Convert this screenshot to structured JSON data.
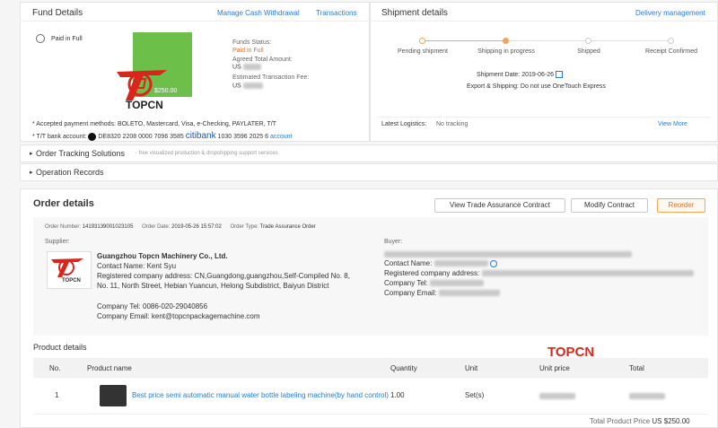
{
  "fund": {
    "title": "Fund Details",
    "manage_link": "Manage Cash Withdrawal",
    "transactions_link": "Transactions",
    "paid_badge": "Paid in Full",
    "funds_status_label": "Funds Status:",
    "funds_status_value": "Paid in Full",
    "agreed_total_label": "Agreed Total Amount:",
    "agreed_total_prefix": "US",
    "est_fee_label": "Estimated Transaction Fee:",
    "est_fee_prefix": "US",
    "paid_amount": "$250.00",
    "payment_methods": "* Accepted payment methods: BOLETO, Mastercard, Visa, e-Checking, PAYLATER, T/T",
    "tt_label": "* T/T bank account:",
    "bank1_no": "DE8320 2208 0000 7096 3585",
    "citibank": "citibank",
    "bank2_no": "1030 3596 2025 6",
    "account_link": "account"
  },
  "shipment": {
    "title": "Shipment details",
    "delivery_link": "Delivery management",
    "steps": [
      "Pending shipment",
      "Shipping in progress",
      "Shipped",
      "Receipt Confirmed"
    ],
    "shipment_date_label": "Shipment Date:",
    "shipment_date": "2019-06-26",
    "export_shipping": "Export & Shipping:  Do not use OneTouch Express",
    "latest_logistics_label": "Latest Logistics:",
    "latest_logistics_value": "No tracking",
    "view_more": "View More"
  },
  "sections": {
    "tracking_title": "Order Tracking Solutions",
    "tracking_sub": "- free visualized production & dropshipping support services",
    "operation_title": "Operation Records"
  },
  "order": {
    "title": "Order details",
    "btn_contract": "View Trade Assurance Contract",
    "btn_modify": "Modify Contract",
    "btn_reorder": "Reorder",
    "number_label": "Order Number:",
    "number": "14193139001023105",
    "date_label": "Order Date:",
    "date": "2019-05-26 15:57:02",
    "type_label": "Order Type:",
    "type": "Trade Assurance Order",
    "supplier_label": "Supplier:",
    "buyer_label": "Buyer:",
    "supplier": {
      "name": "Guangzhou Topcn Machinery Co., Ltd.",
      "contact": "Contact Name: Kent Syu",
      "address": "Registered company address: CN,Guangdong,guangzhou,Self-Compiled No. 8, No. 11, North Street, Hebian Yuancun, Helong Subdistrict, Baiyun District",
      "tel": "Company Tel:  0086-020-29040856",
      "email": "Company Email: kent@topcnpackagemachine.com"
    },
    "buyer": {
      "contact": "Contact Name:",
      "address": "Registered company address:",
      "tel": "Company Tel:",
      "email": "Company Email:"
    }
  },
  "products": {
    "title": "Product details",
    "watermark": "TOPCN",
    "headers": [
      "No.",
      "Product name",
      "Quantity",
      "Unit",
      "Unit price",
      "Total"
    ],
    "rows": [
      {
        "no": "1",
        "name": "Best price semi automatic manual water bottle labeling machine(by hand control)",
        "quantity": "1.00",
        "unit": "Set(s)"
      }
    ],
    "total_label": "Total Product Price",
    "total_value": "US $250.00"
  },
  "logo_text": "TOPCN",
  "colors": {
    "accent": "#2b7bd3",
    "orange": "#e8701f",
    "green": "#6cc04a",
    "logo_red": "#d8261c"
  }
}
